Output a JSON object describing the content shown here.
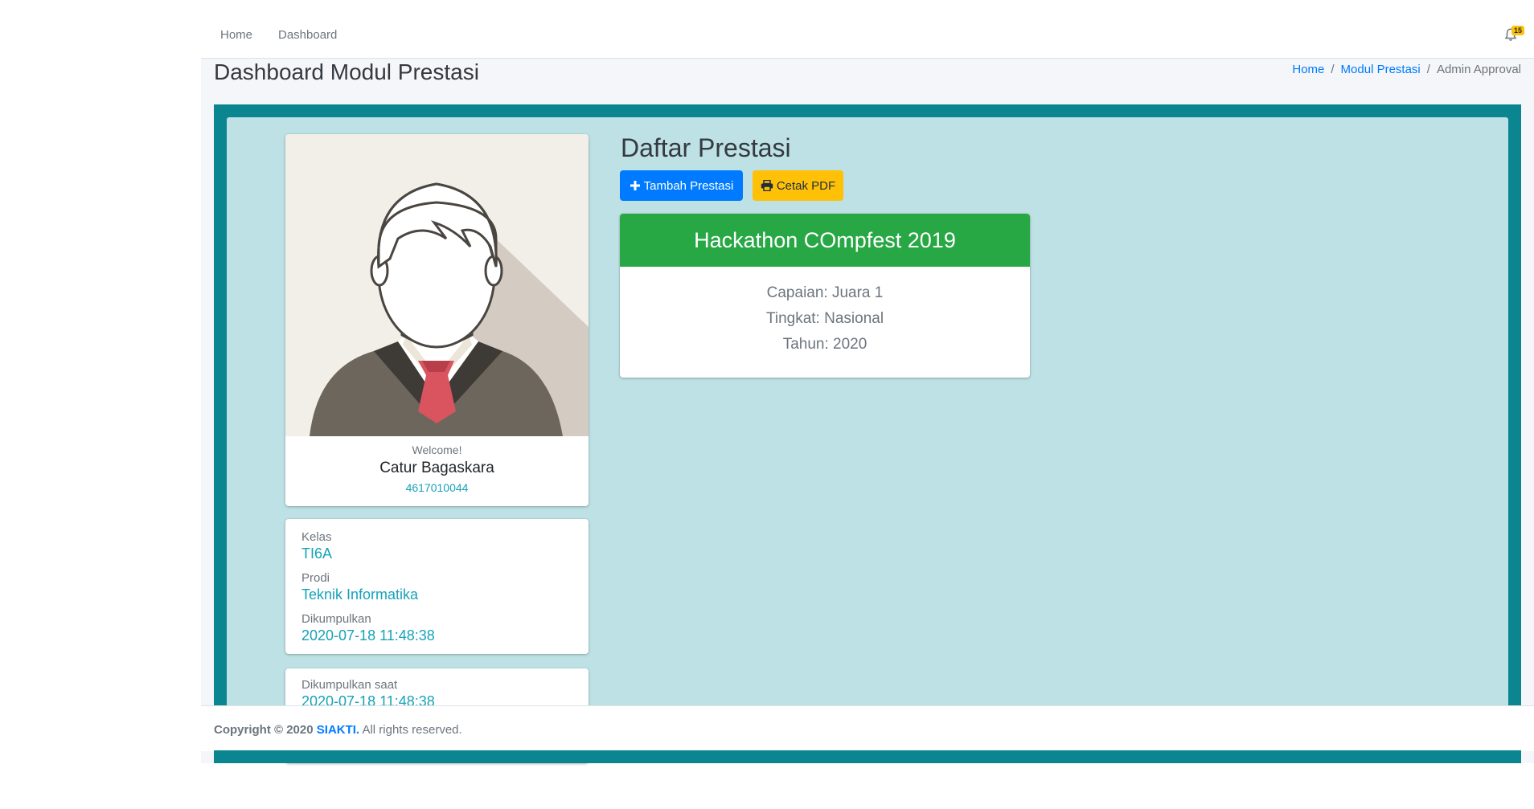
{
  "nav": {
    "home": "Home",
    "dashboard": "Dashboard",
    "notification_count": "15"
  },
  "header": {
    "title": "Dashboard Modul Prestasi",
    "breadcrumb": [
      "Home",
      "Modul Prestasi",
      "Admin Approval"
    ]
  },
  "profile": {
    "welcome": "Welcome!",
    "name": "Catur Bagaskara",
    "nim": "4617010044"
  },
  "info": {
    "kelas_label": "Kelas",
    "kelas_value": "TI6A",
    "prodi_label": "Prodi",
    "prodi_value": "Teknik Informatika",
    "dikumpulkan_label": "Dikumpulkan",
    "dikumpulkan_value": "2020-07-18 11:48:38",
    "dikumpulkan_saat_label": "Dikumpulkan saat",
    "dikumpulkan_saat_value": "2020-07-18 11:48:38"
  },
  "prestasi": {
    "section_title": "Daftar Prestasi",
    "add_button": "Tambah Prestasi",
    "pdf_button": "Cetak PDF",
    "items": [
      {
        "title": "Hackathon COmpfest 2019",
        "capaian": "Capaian: Juara 1",
        "tingkat": "Tingkat: Nasional",
        "tahun": "Tahun: 2020"
      }
    ]
  },
  "footer": {
    "copyright": "Copyright © 2020",
    "brand": "SIAKTI.",
    "rights": "All rights reserved."
  },
  "colors": {
    "primary": "#007bff",
    "warning": "#ffc107",
    "success": "#28a745",
    "teal_frame": "#0b8590",
    "panel_bg": "#bde1e4",
    "info_text": "#17a2b8"
  }
}
